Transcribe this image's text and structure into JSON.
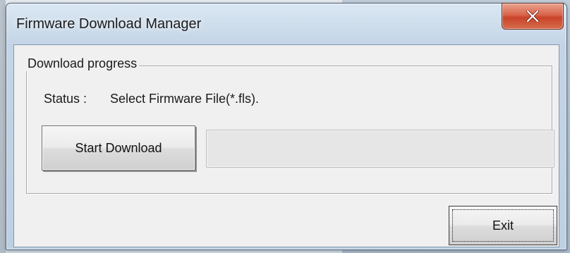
{
  "window": {
    "title": "Firmware Download Manager",
    "close_icon": "close-icon"
  },
  "group": {
    "legend": "Download progress",
    "status_label": "Status :",
    "status_value": "Select Firmware File(*.fls)."
  },
  "buttons": {
    "start_download": "Start Download",
    "exit": "Exit"
  },
  "progress": {
    "value": 0
  },
  "colors": {
    "close_button": "#d9634b",
    "client_background": "#f0f0f0"
  }
}
